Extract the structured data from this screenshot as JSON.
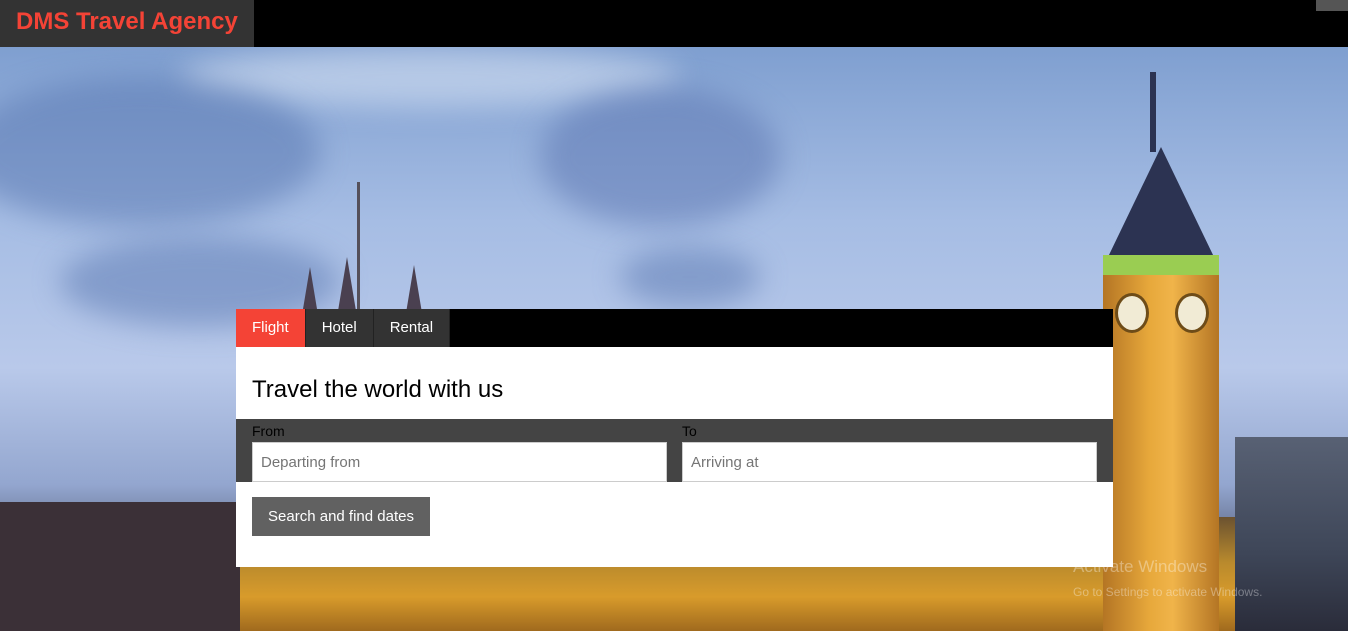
{
  "header": {
    "brand": "DMS Travel Agency"
  },
  "booking": {
    "tabs": [
      {
        "label": "Flight",
        "active": true
      },
      {
        "label": "Hotel",
        "active": false
      },
      {
        "label": "Rental",
        "active": false
      }
    ],
    "title": "Travel the world with us",
    "from": {
      "label": "From",
      "placeholder": "Departing from",
      "value": ""
    },
    "to": {
      "label": "To",
      "placeholder": "Arriving at",
      "value": ""
    },
    "search_label": "Search and find dates"
  },
  "os_watermark": {
    "line1": "Activate Windows",
    "line2": "Go to Settings to activate Windows."
  },
  "colors": {
    "accent": "#f44336",
    "topbar": "#000000",
    "brand_bg": "#333333",
    "field_row_bg": "#444444",
    "button_bg": "#616161"
  }
}
